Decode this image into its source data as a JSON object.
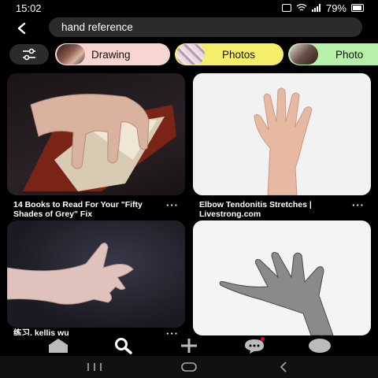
{
  "status_bar": {
    "time": "15:02",
    "battery_text": "79%"
  },
  "search": {
    "query": "hand reference"
  },
  "chips": [
    {
      "label": "Drawing",
      "bg": "#f9d5d0"
    },
    {
      "label": "Photos",
      "bg": "#f4ee6a"
    },
    {
      "label": "Photo",
      "bg": "#b7f0a8"
    }
  ],
  "pins": [
    {
      "title": "14 Books to Read For Your \"Fifty Shades of Grey\" Fix",
      "more": "···"
    },
    {
      "title": "Elbow Tendonitis Stretches | Livestrong.com",
      "more": "···"
    },
    {
      "title": "练习. kellis wu",
      "more": "···"
    },
    {
      "title": "",
      "more": ""
    }
  ],
  "bottom_nav": {
    "items": [
      "home-icon",
      "search-icon",
      "plus-icon",
      "chat-icon",
      "profile-icon"
    ],
    "active": "search-icon"
  },
  "colors": {
    "background": "#000000",
    "search_bg": "#2b2b2b",
    "notification": "#e60023"
  }
}
